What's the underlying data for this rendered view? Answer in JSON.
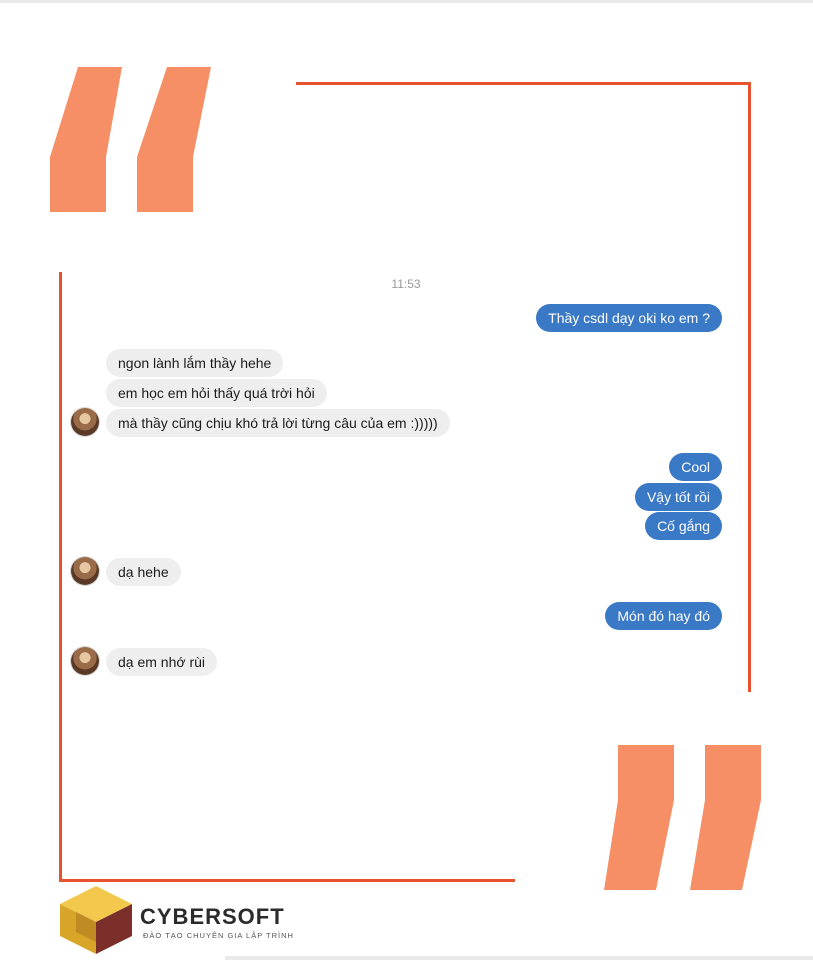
{
  "timestamp": "11:53",
  "messages": [
    {
      "side": "out",
      "text": "Thầy csdl dạy oki ko em ?"
    },
    {
      "side": "in",
      "text": "ngon lành lắm thầy hehe"
    },
    {
      "side": "in",
      "text": "em học em hỏi thấy quá trời hỏi"
    },
    {
      "side": "in",
      "text": "mà thầy cũng chịu khó trả lời từng câu của em :)))))"
    },
    {
      "side": "out",
      "text": "Cool"
    },
    {
      "side": "out",
      "text": "Vậy tốt rồi"
    },
    {
      "side": "out",
      "text": "Cố gắng"
    },
    {
      "side": "in",
      "text": "dạ hehe"
    },
    {
      "side": "out",
      "text": "Món đó hay đó"
    },
    {
      "side": "in",
      "text": "dạ em nhớ rùi"
    }
  ],
  "brand": {
    "name": "CYBERSOFT",
    "tagline": "ĐÀO TẠO CHUYÊN GIA LẬP TRÌNH"
  },
  "colors": {
    "frame": "#e8532f",
    "quote": "#f78f66",
    "outgoing_bubble": "#3a79c6",
    "incoming_bubble": "#eeeeee"
  }
}
